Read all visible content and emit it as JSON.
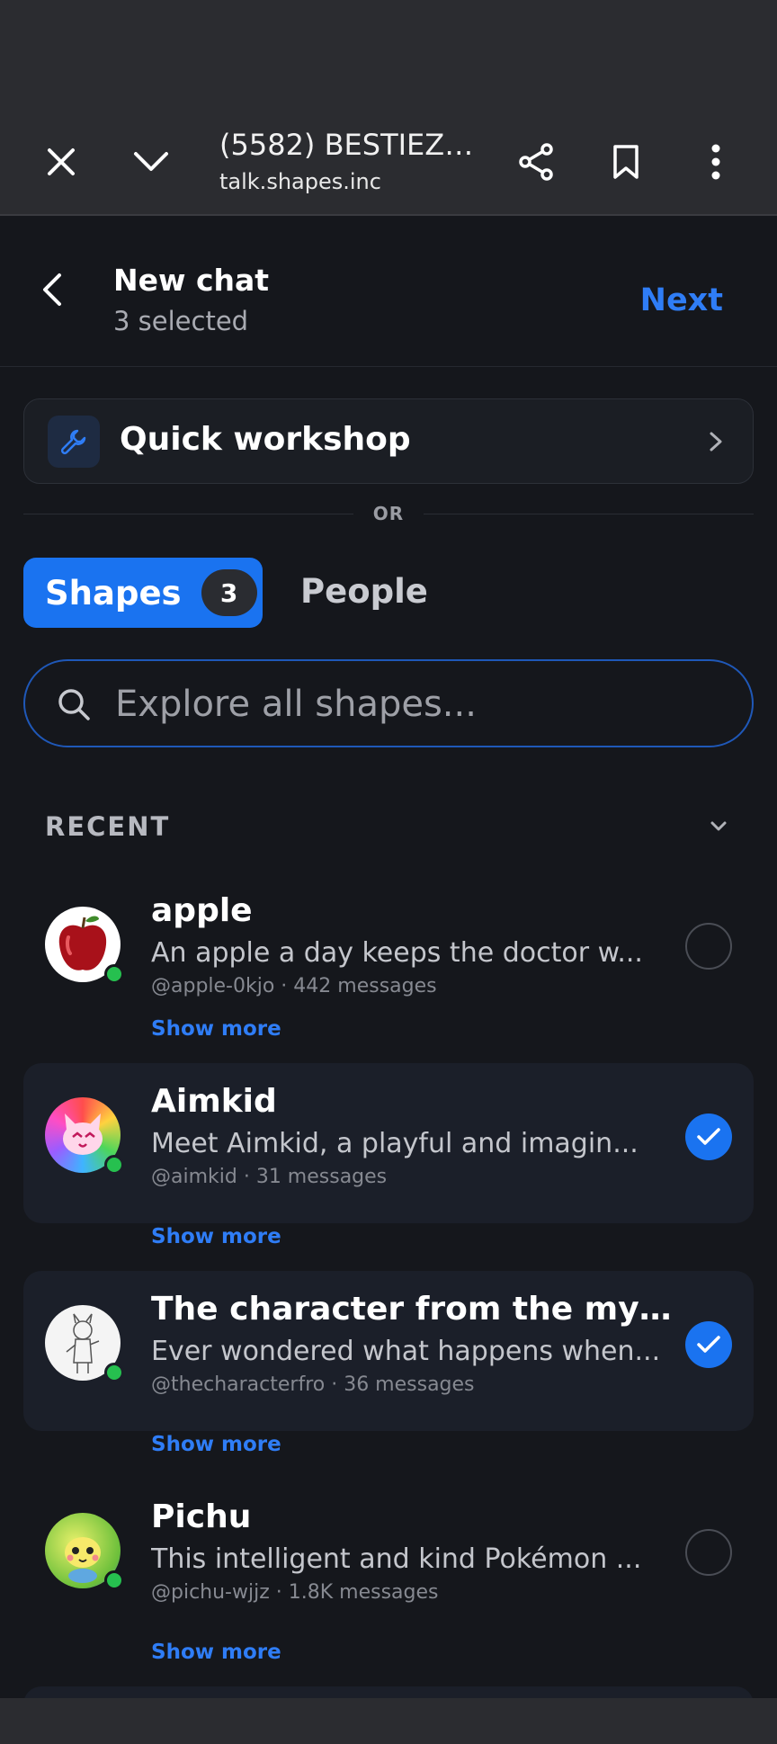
{
  "browser": {
    "title": "(5582) BESTIEZZ...",
    "url": "talk.shapes.inc"
  },
  "header": {
    "title": "New chat",
    "subtitle": "3 selected",
    "next_label": "Next"
  },
  "workshop": {
    "label": "Quick workshop"
  },
  "divider": {
    "text": "OR"
  },
  "tabs": {
    "shapes_label": "Shapes",
    "shapes_count": "3",
    "people_label": "People"
  },
  "search": {
    "placeholder": "Explore all shapes..."
  },
  "recent": {
    "label": "RECENT"
  },
  "items": [
    {
      "name": "apple",
      "desc": "An apple a day keeps the doctor w...",
      "meta": "@apple-0kjo · 442 messages",
      "selected": false
    },
    {
      "name": "Aimkid",
      "desc": "Meet Aimkid, a playful and imagin...",
      "meta": "@aimkid · 31 messages",
      "selected": true
    },
    {
      "name": "The character from the my tr...",
      "desc": "Ever wondered what happens when...",
      "meta": "@thecharacterfro · 36 messages",
      "selected": true
    },
    {
      "name": "Pichu",
      "desc": "This intelligent and kind Pokémon ...",
      "meta": "@pichu-wjjz · 1.8K messages",
      "selected": false
    }
  ],
  "show_more_label": "Show more",
  "colors": {
    "accent": "#1a73f0",
    "link": "#2f7df6",
    "online": "#26c04f",
    "background": "#15171c"
  }
}
